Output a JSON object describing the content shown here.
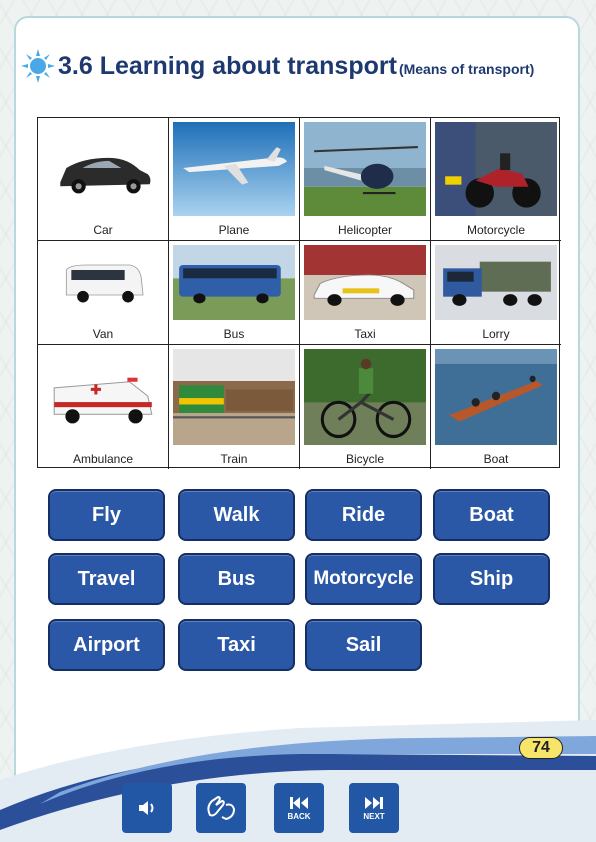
{
  "header": {
    "title": "3.6 Learning about transport",
    "subtitle": "(Means of transport)"
  },
  "transport_grid": [
    {
      "label": "Car",
      "icon": "car-photo"
    },
    {
      "label": "Plane",
      "icon": "plane-photo"
    },
    {
      "label": "Helicopter",
      "icon": "helicopter-photo"
    },
    {
      "label": "Motorcycle",
      "icon": "motorcycle-photo"
    },
    {
      "label": "Van",
      "icon": "van-photo"
    },
    {
      "label": "Bus",
      "icon": "bus-photo"
    },
    {
      "label": "Taxi",
      "icon": "taxi-photo"
    },
    {
      "label": "Lorry",
      "icon": "lorry-photo"
    },
    {
      "label": "Ambulance",
      "icon": "ambulance-photo"
    },
    {
      "label": "Train",
      "icon": "train-photo"
    },
    {
      "label": "Bicycle",
      "icon": "bicycle-photo"
    },
    {
      "label": "Boat",
      "icon": "boat-photo"
    }
  ],
  "word_buttons": [
    "Fly",
    "Walk",
    "Ride",
    "Boat",
    "Travel",
    "Bus",
    "Motorcycle",
    "Ship",
    "Airport",
    "Taxi",
    "Sail"
  ],
  "footer": {
    "page_number": "74",
    "back_label": "BACK",
    "next_label": "NEXT"
  },
  "colors": {
    "title": "#1d3970",
    "button_fill": "#2b57a7",
    "button_border": "#152e63",
    "control_fill": "#2257a6",
    "page_badge": "#f7e56a"
  }
}
